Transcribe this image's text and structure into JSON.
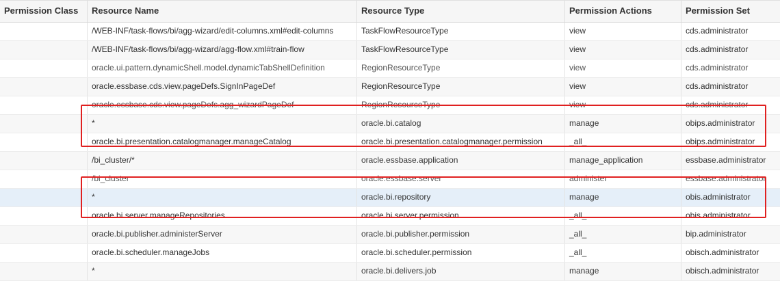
{
  "columns": [
    "Permission Class",
    "Resource Name",
    "Resource Type",
    "Permission Actions",
    "Permission Set"
  ],
  "rows": [
    {
      "class": "",
      "resource_name": "/WEB-INF/task-flows/bi/agg-wizard/edit-columns.xml#edit-columns",
      "resource_type": "TaskFlowResourceType",
      "actions": "view",
      "permission_set": "cds.administrator"
    },
    {
      "class": "",
      "resource_name": "/WEB-INF/task-flows/bi/agg-wizard/agg-flow.xml#train-flow",
      "resource_type": "TaskFlowResourceType",
      "actions": "view",
      "permission_set": "cds.administrator"
    },
    {
      "class": "",
      "resource_name": "oracle.ui.pattern.dynamicShell.model.dynamicTabShellDefinition",
      "resource_type": "RegionResourceType",
      "actions": "view",
      "permission_set": "cds.administrator"
    },
    {
      "class": "",
      "resource_name": "oracle.essbase.cds.view.pageDefs.SignInPageDef",
      "resource_type": "RegionResourceType",
      "actions": "view",
      "permission_set": "cds.administrator"
    },
    {
      "class": "",
      "resource_name": "oracle.essbase.cds.view.pageDefs.agg_wizardPageDef",
      "resource_type": "RegionResourceType",
      "actions": "view",
      "permission_set": "cds.administrator"
    },
    {
      "class": "",
      "resource_name": "*",
      "resource_type": "oracle.bi.catalog",
      "actions": "manage",
      "permission_set": "obips.administrator"
    },
    {
      "class": "",
      "resource_name": "oracle.bi.presentation.catalogmanager.manageCatalog",
      "resource_type": "oracle.bi.presentation.catalogmanager.permission",
      "actions": "_all_",
      "permission_set": "obips.administrator"
    },
    {
      "class": "",
      "resource_name": "/bi_cluster/*",
      "resource_type": "oracle.essbase.application",
      "actions": "manage_application",
      "permission_set": "essbase.administrator"
    },
    {
      "class": "",
      "resource_name": "/bi_cluster",
      "resource_type": "oracle.essbase.server",
      "actions": "administer",
      "permission_set": "essbase.administrator"
    },
    {
      "class": "",
      "resource_name": "*",
      "resource_type": "oracle.bi.repository",
      "actions": "manage",
      "permission_set": "obis.administrator"
    },
    {
      "class": "",
      "resource_name": "oracle.bi.server.manageRepositories",
      "resource_type": "oracle.bi.server.permission",
      "actions": "_all_",
      "permission_set": "obis.administrator"
    },
    {
      "class": "",
      "resource_name": "oracle.bi.publisher.administerServer",
      "resource_type": "oracle.bi.publisher.permission",
      "actions": "_all_",
      "permission_set": "bip.administrator"
    },
    {
      "class": "",
      "resource_name": "oracle.bi.scheduler.manageJobs",
      "resource_type": "oracle.bi.scheduler.permission",
      "actions": "_all_",
      "permission_set": "obisch.administrator"
    },
    {
      "class": "",
      "resource_name": "*",
      "resource_type": "oracle.bi.delivers.job",
      "actions": "manage",
      "permission_set": "obisch.administrator"
    }
  ],
  "colors": {
    "highlight_border": "#e02020",
    "selected_row": "#e5eff9"
  }
}
